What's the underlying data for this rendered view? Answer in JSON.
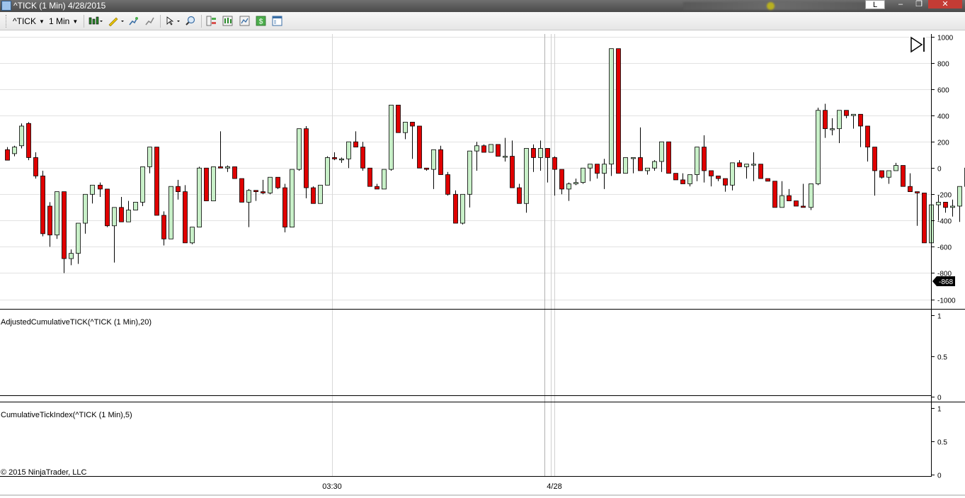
{
  "window": {
    "title": "^TICK (1 Min)  4/28/2015",
    "buttons": {
      "left_tab": "L",
      "minimize": "–",
      "maximize": "❐",
      "close": "✕"
    }
  },
  "toolbar": {
    "instrument": "^TICK",
    "interval": "1 Min",
    "icons": [
      "candlestick-style-icon",
      "pencil-draw-icon",
      "add-indicator-icon",
      "strategy-icon",
      "pointer-icon",
      "zoom-icon",
      "data-box-icon",
      "chart-trader-icon",
      "chart-properties-icon",
      "dollar-icon",
      "template-icon"
    ]
  },
  "colors": {
    "up_body": "#c8f0c8",
    "down_body": "#e00000",
    "wick": "#000000",
    "last_price_bg": "#000000"
  },
  "panels": [
    {
      "label": "",
      "ticks": [
        "1000",
        "800",
        "600",
        "400",
        "200",
        "0",
        "-200",
        "-400",
        "-600",
        "-800",
        "-1000"
      ],
      "last_price": "-868"
    },
    {
      "label": "AdjustedCumulativeTICK(^TICK (1 Min),20)",
      "ticks": [
        "1",
        "0.5",
        "0"
      ]
    },
    {
      "label": "CumulativeTickIndex(^TICK (1 Min),5)",
      "ticks": [
        "1",
        "0.5",
        "0"
      ]
    }
  ],
  "time_axis": [
    "03:30",
    "4/28"
  ],
  "copyright": "© 2015 NinjaTrader, LLC",
  "chart_data": {
    "type": "candlestick",
    "ylim": [
      -1000,
      1000
    ],
    "grid": true,
    "candles": [
      [
        140,
        160,
        100,
        60
      ],
      [
        110,
        170,
        90,
        160
      ],
      [
        170,
        340,
        150,
        320
      ],
      [
        340,
        350,
        60,
        80
      ],
      [
        80,
        120,
        -80,
        -60
      ],
      [
        -60,
        -20,
        -520,
        -500
      ],
      [
        -290,
        -260,
        -600,
        -510
      ],
      [
        -510,
        -180,
        -540,
        -180
      ],
      [
        -180,
        -190,
        -800,
        -690
      ],
      [
        -690,
        -620,
        -740,
        -650
      ],
      [
        -650,
        -630,
        -730,
        -420
      ],
      [
        -420,
        -400,
        -500,
        -200
      ],
      [
        -200,
        -140,
        -270,
        -130
      ],
      [
        -130,
        -110,
        -220,
        -160
      ],
      [
        -160,
        -160,
        -450,
        -440
      ],
      [
        -440,
        -310,
        -720,
        -300
      ],
      [
        -300,
        -220,
        -370,
        -410
      ],
      [
        -410,
        -250,
        -380,
        -320
      ],
      [
        -320,
        -310,
        -320,
        -260
      ],
      [
        -260,
        0,
        -290,
        10
      ],
      [
        10,
        150,
        -40,
        160
      ],
      [
        160,
        160,
        -360,
        -360
      ],
      [
        -360,
        -330,
        -590,
        -540
      ],
      [
        -540,
        -510,
        -540,
        -140
      ],
      [
        -140,
        -90,
        -240,
        -180
      ],
      [
        -180,
        -130,
        -470,
        -570
      ],
      [
        -570,
        -560,
        -580,
        -450
      ],
      [
        -450,
        10,
        -430,
        0
      ],
      [
        0,
        0,
        -10,
        -250
      ],
      [
        -250,
        -20,
        -200,
        10
      ],
      [
        10,
        280,
        0,
        0
      ],
      [
        0,
        20,
        -30,
        10
      ],
      [
        10,
        0,
        -80,
        -80
      ],
      [
        -80,
        -80,
        -260,
        -260
      ],
      [
        -260,
        -160,
        -450,
        -170
      ],
      [
        -170,
        -230,
        -250,
        -180
      ],
      [
        -180,
        -90,
        -200,
        -190
      ],
      [
        -190,
        -140,
        -200,
        -70
      ],
      [
        -70,
        -120,
        -160,
        -150
      ],
      [
        -150,
        -120,
        -490,
        -450
      ],
      [
        -450,
        -440,
        -430,
        -10
      ],
      [
        -10,
        -10,
        -20,
        300
      ],
      [
        300,
        320,
        -230,
        -150
      ],
      [
        -150,
        -140,
        -250,
        -270
      ],
      [
        -270,
        -170,
        -270,
        -130
      ],
      [
        -130,
        90,
        -130,
        80
      ],
      [
        80,
        120,
        60,
        70
      ],
      [
        70,
        80,
        40,
        70
      ],
      [
        70,
        190,
        0,
        200
      ],
      [
        200,
        280,
        160,
        160
      ],
      [
        160,
        200,
        -20,
        0
      ],
      [
        0,
        0,
        -130,
        -140
      ],
      [
        -140,
        -120,
        -150,
        -160
      ],
      [
        -160,
        -20,
        -150,
        -10
      ],
      [
        -10,
        400,
        -20,
        480
      ],
      [
        480,
        450,
        270,
        270
      ],
      [
        270,
        320,
        220,
        350
      ],
      [
        350,
        300,
        70,
        320
      ],
      [
        320,
        140,
        0,
        0
      ],
      [
        0,
        -20,
        -20,
        -10
      ],
      [
        -10,
        120,
        -160,
        140
      ],
      [
        140,
        170,
        -40,
        -50
      ],
      [
        -50,
        -30,
        -210,
        -200
      ],
      [
        -200,
        -170,
        -380,
        -420
      ],
      [
        -420,
        -380,
        -430,
        -200
      ],
      [
        -200,
        -170,
        -300,
        130
      ],
      [
        130,
        200,
        -20,
        170
      ],
      [
        170,
        180,
        150,
        120
      ],
      [
        120,
        110,
        130,
        180
      ],
      [
        180,
        180,
        150,
        90
      ],
      [
        90,
        230,
        50,
        90
      ],
      [
        90,
        210,
        30,
        -150
      ],
      [
        -150,
        -120,
        -270,
        -270
      ],
      [
        -270,
        -140,
        -340,
        150
      ],
      [
        150,
        180,
        -30,
        80
      ],
      [
        80,
        210,
        -20,
        150
      ],
      [
        150,
        140,
        -110,
        80
      ],
      [
        80,
        90,
        -210,
        -10
      ],
      [
        -10,
        -160,
        -200,
        -160
      ],
      [
        -160,
        -110,
        -250,
        -120
      ],
      [
        -120,
        -80,
        -130,
        -110
      ],
      [
        -110,
        -80,
        -120,
        0
      ],
      [
        0,
        20,
        -100,
        30
      ],
      [
        30,
        30,
        -80,
        -40
      ],
      [
        -40,
        70,
        -160,
        30
      ],
      [
        30,
        100,
        -60,
        910
      ],
      [
        910,
        900,
        -10,
        -40
      ],
      [
        -40,
        -40,
        10,
        80
      ],
      [
        80,
        -10,
        -40,
        80
      ],
      [
        80,
        310,
        -10,
        -20
      ],
      [
        -20,
        -30,
        -50,
        0
      ],
      [
        0,
        60,
        -20,
        50
      ],
      [
        50,
        160,
        -30,
        200
      ],
      [
        200,
        160,
        -20,
        -40
      ],
      [
        -40,
        -40,
        -60,
        -90
      ],
      [
        -90,
        -40,
        -110,
        -120
      ],
      [
        -120,
        -100,
        -140,
        -50
      ],
      [
        -50,
        40,
        -100,
        160
      ],
      [
        160,
        250,
        -110,
        -20
      ],
      [
        -20,
        -70,
        -140,
        -60
      ],
      [
        -60,
        -60,
        -100,
        -80
      ],
      [
        -80,
        -130,
        -180,
        -130
      ],
      [
        -130,
        -80,
        -170,
        40
      ],
      [
        40,
        60,
        60,
        10
      ],
      [
        10,
        -30,
        -80,
        30
      ],
      [
        30,
        120,
        -100,
        30
      ],
      [
        30,
        30,
        -80,
        -80
      ],
      [
        -80,
        -90,
        -100,
        -100
      ],
      [
        -100,
        -150,
        -240,
        -300
      ],
      [
        -300,
        -100,
        -290,
        -210
      ],
      [
        -210,
        -160,
        -250,
        -250
      ],
      [
        -250,
        -280,
        -280,
        -290
      ],
      [
        -290,
        -120,
        -160,
        -300
      ],
      [
        -300,
        -160,
        -320,
        -120
      ],
      [
        -120,
        460,
        -130,
        440
      ],
      [
        440,
        490,
        230,
        300
      ],
      [
        300,
        380,
        250,
        300
      ],
      [
        300,
        420,
        190,
        440
      ],
      [
        440,
        400,
        380,
        400
      ],
      [
        400,
        400,
        300,
        410
      ],
      [
        410,
        380,
        160,
        320
      ],
      [
        320,
        220,
        50,
        160
      ],
      [
        160,
        130,
        -210,
        -20
      ],
      [
        -20,
        -40,
        -80,
        -70
      ],
      [
        -70,
        -40,
        -120,
        -20
      ],
      [
        -20,
        40,
        -20,
        20
      ],
      [
        20,
        -220,
        -120,
        -140
      ],
      [
        -140,
        -40,
        -150,
        -180
      ],
      [
        -180,
        -220,
        -440,
        -190
      ],
      [
        -190,
        -200,
        -530,
        -570
      ],
      [
        -570,
        -200,
        -560,
        -280
      ],
      [
        -280,
        -210,
        -400,
        -260
      ],
      [
        -260,
        -280,
        -340,
        -300
      ],
      [
        -300,
        -240,
        -370,
        -290
      ],
      [
        -290,
        -180,
        -410,
        -140
      ],
      [
        -140,
        60,
        -190,
        0
      ],
      [
        0,
        -250,
        -390,
        -350
      ],
      [
        -350,
        -400,
        -600,
        -260
      ],
      [
        -260,
        -250,
        -340,
        -360
      ],
      [
        -360,
        -270,
        -510,
        -390
      ],
      [
        -390,
        -420,
        -680,
        -660
      ],
      [
        -660,
        -490,
        -690,
        -430
      ],
      [
        -430,
        -370,
        -450,
        -230
      ],
      [
        -230,
        -160,
        -260,
        -180
      ],
      [
        -180,
        -140,
        -200,
        -500
      ],
      [
        -500,
        -500,
        -810,
        -930
      ],
      [
        -930,
        -860,
        -880,
        -880
      ]
    ]
  }
}
